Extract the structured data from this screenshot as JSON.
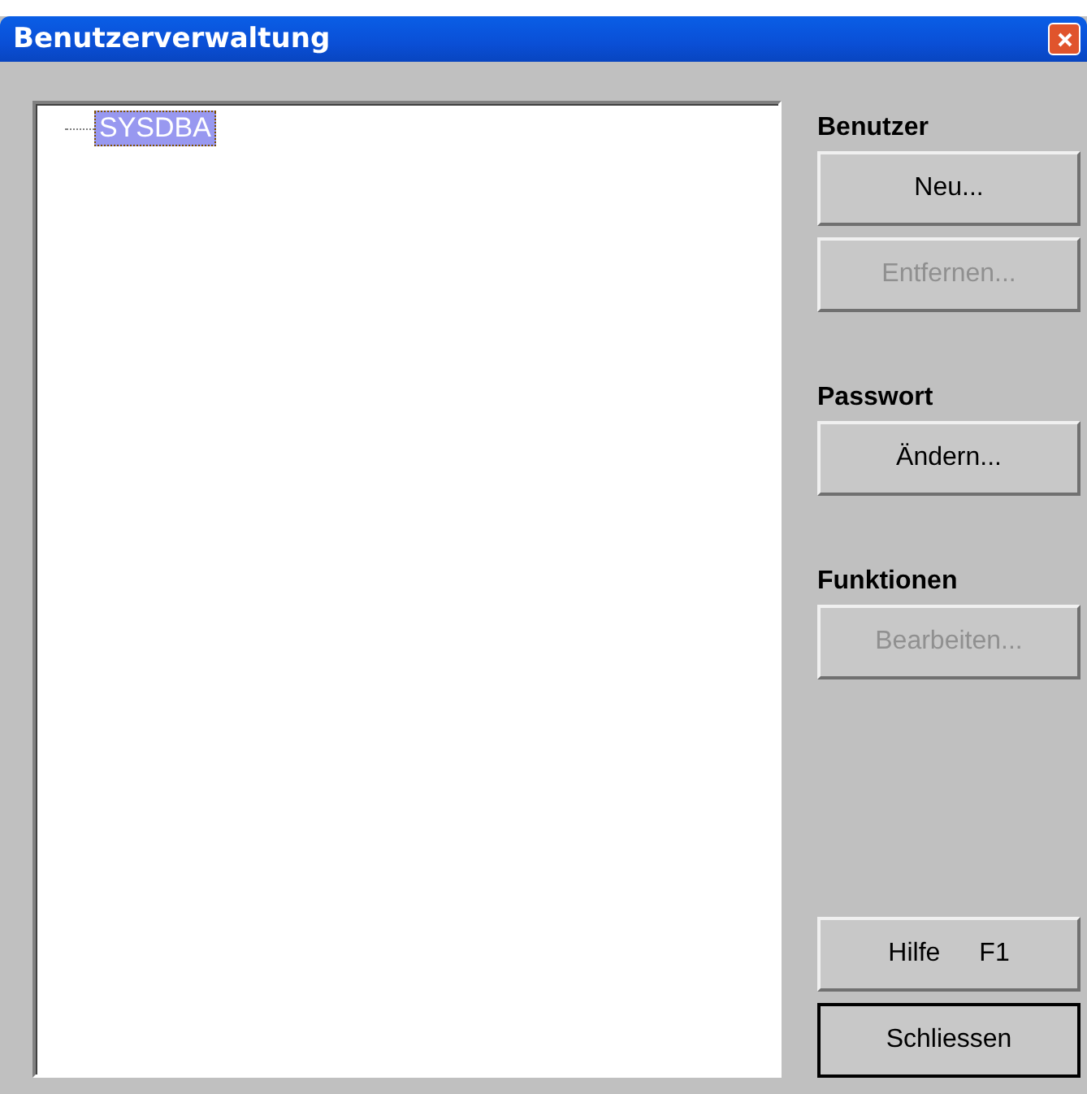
{
  "window": {
    "title": "Benutzerverwaltung"
  },
  "tree": {
    "items": [
      {
        "label": "SYSDBA",
        "selected": true
      }
    ]
  },
  "sections": [
    {
      "heading": "Benutzer",
      "buttons": [
        {
          "label": "Neu...",
          "disabled": false
        },
        {
          "label": "Entfernen...",
          "disabled": true
        }
      ]
    },
    {
      "heading": "Passwort",
      "buttons": [
        {
          "label": "Ändern...",
          "disabled": false
        }
      ]
    },
    {
      "heading": "Funktionen",
      "buttons": [
        {
          "label": "Bearbeiten...",
          "disabled": true
        }
      ]
    }
  ],
  "footer_buttons": [
    {
      "label": "Hilfe",
      "shortcut": "F1",
      "default": false
    },
    {
      "label": "Schliessen",
      "default": true
    }
  ]
}
